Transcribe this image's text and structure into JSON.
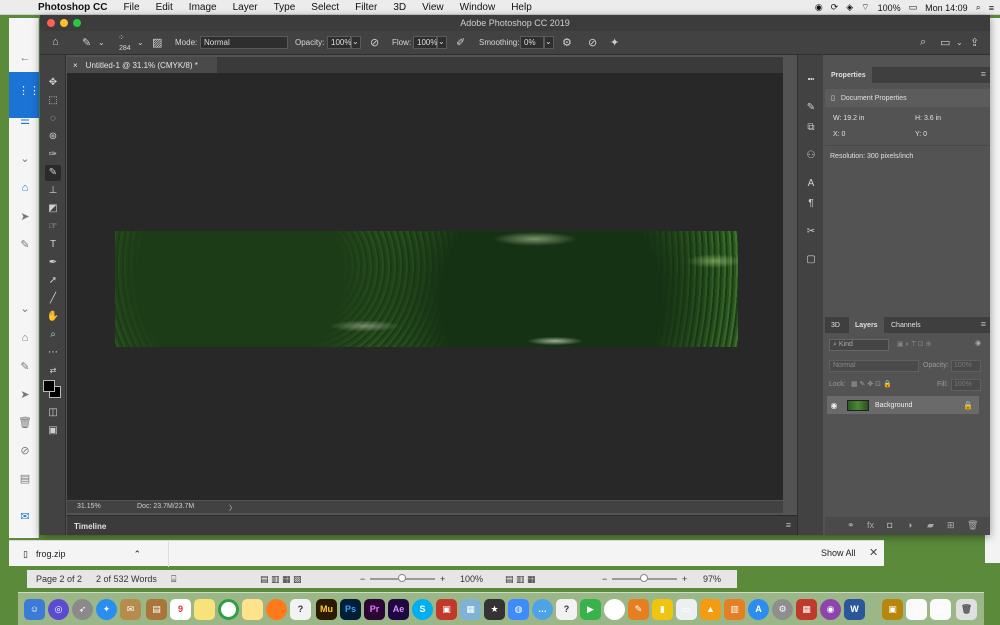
{
  "menubar": {
    "apple_glyph": "",
    "items": [
      "Photoshop CC",
      "File",
      "Edit",
      "Image",
      "Layer",
      "Type",
      "Select",
      "Filter",
      "3D",
      "View",
      "Window",
      "Help"
    ],
    "battery": "100%",
    "clock": "Mon 14:09"
  },
  "photoshop": {
    "window_title": "Adobe Photoshop CC 2019",
    "options": {
      "brush_size": "284",
      "mode_label": "Mode:",
      "mode_value": "Normal",
      "opacity_label": "Opacity:",
      "opacity_value": "100%",
      "flow_label": "Flow:",
      "flow_value": "100%",
      "smoothing_label": "Smoothing:",
      "smoothing_value": "0%"
    },
    "document_tab": "Untitled-1 @ 31.1% (CMYK/8) *",
    "status": {
      "zoom": "31.15%",
      "doc_size": "Doc: 23.7M/23.7M",
      "arrow": "〉"
    },
    "timeline_label": "Timeline",
    "properties": {
      "tab": "Properties",
      "section": "Document Properties",
      "width": "W: 19.2 in",
      "height": "H: 3.6 in",
      "x": "X: 0",
      "y": "Y: 0",
      "resolution": "Resolution: 300 pixels/inch"
    },
    "layers_panel": {
      "tabs": [
        "3D",
        "Layers",
        "Channels"
      ],
      "filter_placeholder": "Kind",
      "blend_mode": "Normal",
      "opacity_label": "Opacity:",
      "opacity_value": "100%",
      "lock_label": "Lock:",
      "fill_label": "Fill:",
      "fill_value": "100%",
      "layers": [
        {
          "name": "Background",
          "visible": true,
          "locked": true
        }
      ]
    }
  },
  "chrome_download": {
    "file": "frog.zip",
    "show_all": "Show All"
  },
  "word_status": {
    "page": "Page 2 of 2",
    "words": "2 of 532 Words",
    "zoom_left": "100%",
    "zoom_right": "97%"
  },
  "dock": {
    "labels": [
      "Mu",
      "Ps",
      "Pr",
      "Ae"
    ],
    "calendar_day": "9",
    "word_letter": "W"
  },
  "colors": {
    "ps_dark": "#535353",
    "canvas": "#282828",
    "accent_blue": "#1b73d6"
  }
}
